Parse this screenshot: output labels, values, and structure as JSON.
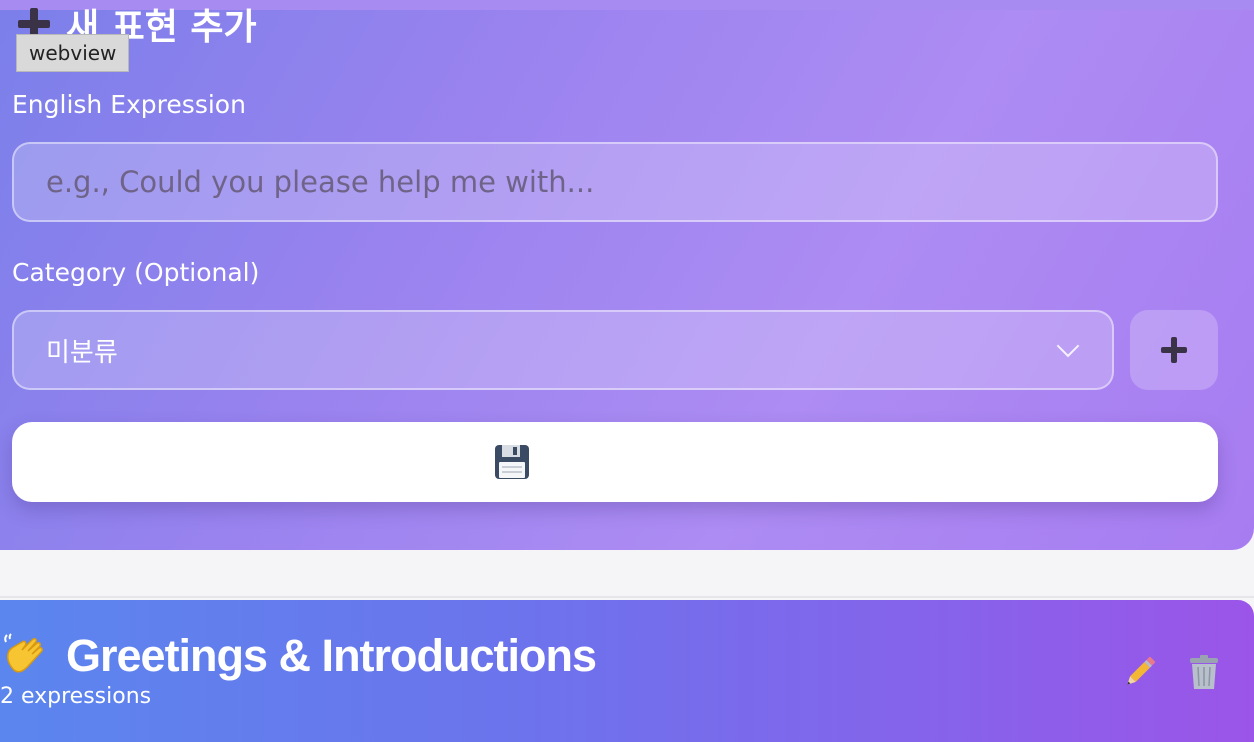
{
  "form": {
    "title": "새 표현 추가",
    "title_icon": "plus-icon",
    "tooltip": "webview",
    "expression_label": "English Expression",
    "expression_placeholder": "e.g., Could you please help me with...",
    "expression_value": "",
    "category_label": "Category (Optional)",
    "category_selected": "미분류",
    "add_category_icon": "plus-icon",
    "save_icon": "floppy-disk-icon"
  },
  "group": {
    "icon": "waving-hand-icon",
    "title": "Greetings & Introductions",
    "count": "2 expressions",
    "edit_icon": "pencil-icon",
    "delete_icon": "trash-icon"
  },
  "colors": {
    "form_gradient_start": "#7b7fea",
    "form_gradient_end": "#a77cf1",
    "group_gradient_start": "#5b86ee",
    "group_gradient_end": "#9b55e8"
  }
}
